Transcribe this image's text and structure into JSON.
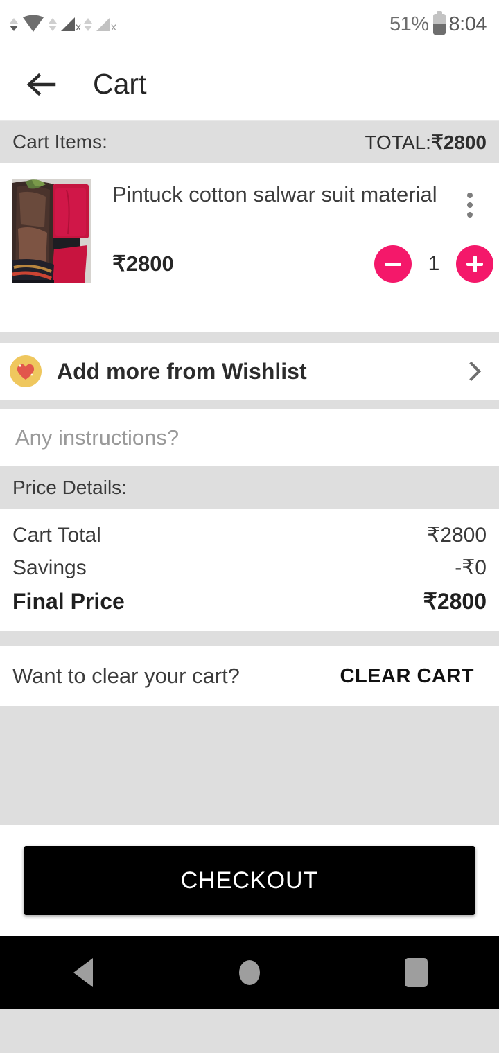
{
  "status_bar": {
    "battery_percent": "51%",
    "time": "8:04",
    "icons": [
      "arrows-up-down-icon",
      "wifi-icon",
      "arrows-up-down-icon",
      "signal-no-sim-icon",
      "arrows-up-down-icon",
      "signal-no-sim-icon",
      "battery-icon"
    ]
  },
  "app_bar": {
    "title": "Cart",
    "back_label": "back-arrow"
  },
  "cart_header": {
    "items_label": "Cart Items:",
    "total_prefix": "TOTAL:",
    "total_value": "₹2800"
  },
  "product": {
    "name": "Pintuck cotton salwar suit material",
    "price": "₹2800",
    "quantity": "1",
    "decrease_label": "minus-icon",
    "increase_label": "plus-icon",
    "menu_label": "more-options"
  },
  "wishlist": {
    "label": "Add more from Wishlist",
    "icon": "heart-icon"
  },
  "instructions": {
    "placeholder": "Any instructions?",
    "value": ""
  },
  "price_details": {
    "heading": "Price Details:",
    "rows": [
      {
        "label": "Cart Total",
        "value": "₹2800"
      },
      {
        "label": "Savings",
        "value": "-₹0"
      }
    ],
    "final": {
      "label": "Final Price",
      "value": "₹2800"
    }
  },
  "clear_cart": {
    "question": "Want to clear your cart?",
    "button": "CLEAR CART"
  },
  "checkout": {
    "label": "CHECKOUT"
  },
  "nav_bar": {
    "back": "nav-back-icon",
    "home": "nav-home-icon",
    "recents": "nav-recents-icon"
  },
  "colors": {
    "accent_pink": "#f4186a",
    "wishlist_gold": "#efc75e",
    "heart_red": "#e2574c",
    "band_gray": "#dedede",
    "checkout_black": "#000000"
  }
}
